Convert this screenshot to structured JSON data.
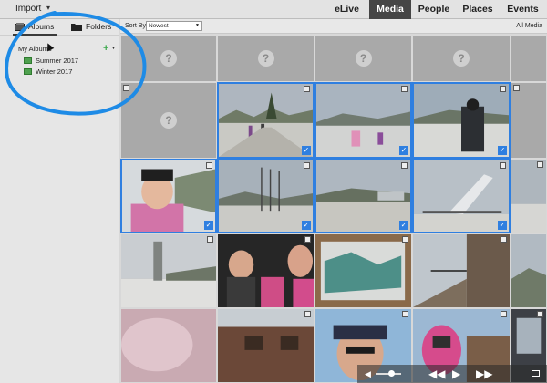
{
  "topbar": {
    "import_label": "Import",
    "nav": [
      {
        "label": "eLive",
        "active": false
      },
      {
        "label": "Media",
        "active": true
      },
      {
        "label": "People",
        "active": false
      },
      {
        "label": "Places",
        "active": false
      },
      {
        "label": "Events",
        "active": false
      }
    ]
  },
  "sidebar": {
    "tabs": {
      "albums": "Albums",
      "folders": "Folders"
    },
    "root_label": "My Albums",
    "albums": [
      {
        "label": "Summer 2017"
      },
      {
        "label": "Winter 2017"
      }
    ]
  },
  "toolbar": {
    "sort_label": "Sort By:",
    "sort_value": "Newest",
    "all_media": "All Media"
  },
  "colors": {
    "accent": "#2f7fe0",
    "annotation": "#1e8be6",
    "nav_active_bg": "#454545"
  },
  "icons": {
    "import_menu": "chevron-down-icon",
    "albums_tab": "photo-stack-icon",
    "folders_tab": "folder-icon",
    "album": "album-icon",
    "add": "plus-icon",
    "unknown_media": "question-mark-icon",
    "selected": "checkmark-icon",
    "video": "video-icon"
  }
}
